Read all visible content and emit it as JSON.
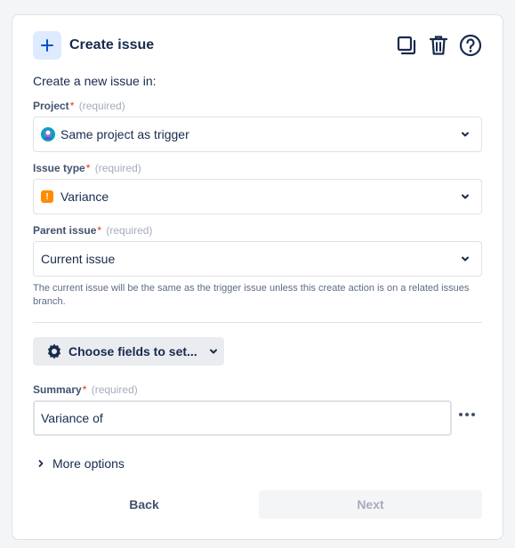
{
  "header": {
    "title": "Create issue",
    "icons": [
      "plus-icon",
      "copy-icon",
      "trash-icon",
      "help-icon"
    ]
  },
  "intro": "Create a new issue in:",
  "fields": {
    "project": {
      "label": "Project",
      "star": "*",
      "required": "(required)",
      "value": "Same project as trigger"
    },
    "issue_type": {
      "label": "Issue type",
      "star": "*",
      "required": "(required)",
      "value": "Variance",
      "icon_glyph": "!"
    },
    "parent_issue": {
      "label": "Parent issue",
      "star": "*",
      "required": "(required)",
      "value": "Current issue"
    },
    "help_text": "The current issue will be the same as the trigger issue unless this create action is on a related issues branch."
  },
  "choose_fields": {
    "label": "Choose fields to set..."
  },
  "summary": {
    "label": "Summary",
    "star": "*",
    "required": "(required)",
    "value": "Variance of"
  },
  "more_options": {
    "label": "More options"
  },
  "footer": {
    "back_label": "Back",
    "next_label": "Next"
  },
  "colors": {
    "accent": "#0052cc",
    "required_star": "#de350b",
    "variance_orange": "#ff8b00"
  }
}
